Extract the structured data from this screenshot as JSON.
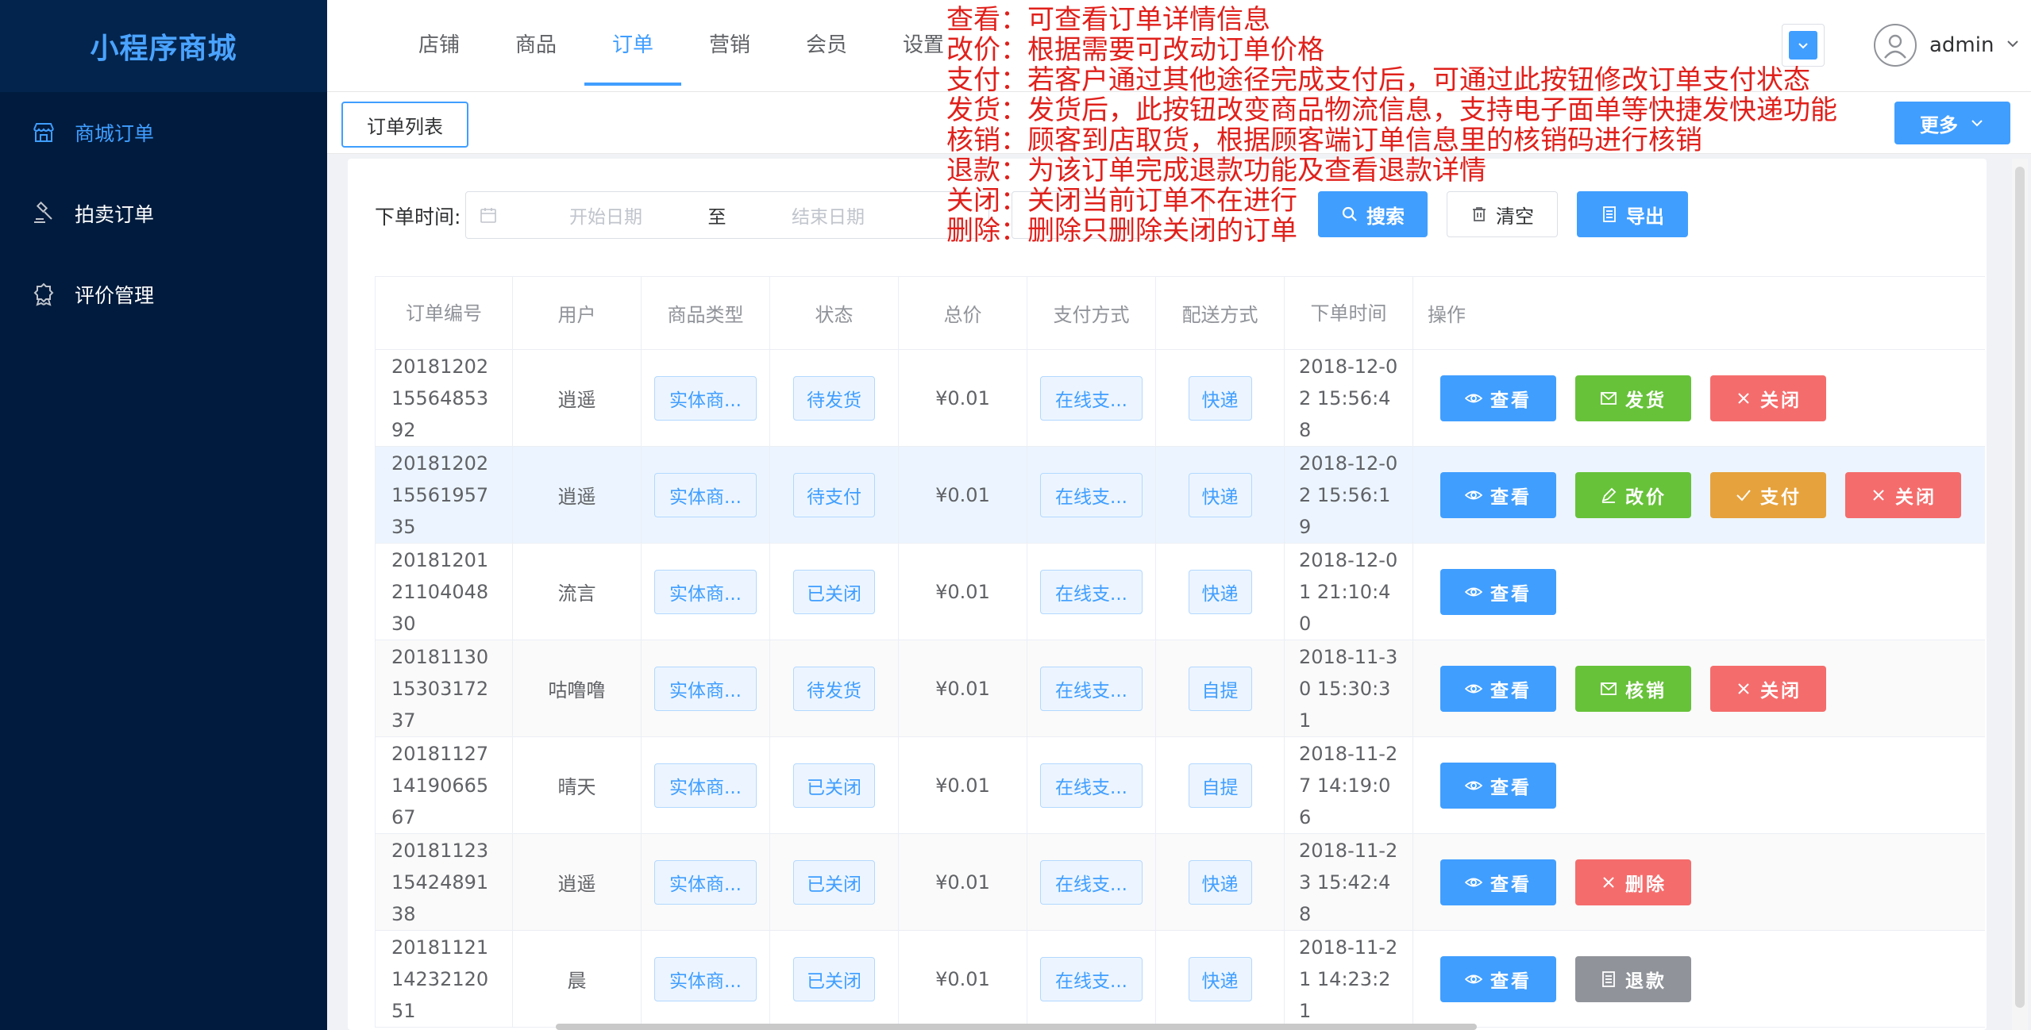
{
  "brand": "小程序商城",
  "sidebar": {
    "items": [
      {
        "label": "商城订单",
        "icon": "store-icon",
        "active": true
      },
      {
        "label": "拍卖订单",
        "icon": "gavel-icon",
        "active": false
      },
      {
        "label": "评价管理",
        "icon": "badge-icon",
        "active": false
      }
    ]
  },
  "nav": {
    "items": [
      "店铺",
      "商品",
      "订单",
      "营销",
      "会员",
      "设置"
    ],
    "active_index": 2
  },
  "user": {
    "name": "admin"
  },
  "tabs": {
    "current": "订单列表",
    "more_label": "更多"
  },
  "filter": {
    "label": "下单时间:",
    "start_placeholder": "开始日期",
    "separator": "至",
    "end_placeholder": "结束日期",
    "search_label": "搜索",
    "clear_label": "清空",
    "export_label": "导出"
  },
  "table": {
    "headers": [
      "订单编号",
      "用户",
      "商品类型",
      "状态",
      "总价",
      "支付方式",
      "配送方式",
      "下单时间",
      "操作"
    ],
    "rows": [
      {
        "id": "201812021556485392",
        "user": "逍遥",
        "type": "实体商...",
        "status": "待发货",
        "total": "¥0.01",
        "pay": "在线支...",
        "ship": "快递",
        "time": "2018-12-02 15:56:48",
        "ops": [
          "查看",
          "发货",
          "关闭"
        ]
      },
      {
        "id": "201812021556195735",
        "user": "逍遥",
        "type": "实体商...",
        "status": "待支付",
        "total": "¥0.01",
        "pay": "在线支...",
        "ship": "快递",
        "time": "2018-12-02 15:56:19",
        "ops": [
          "查看",
          "改价",
          "支付",
          "关闭"
        ]
      },
      {
        "id": "201812012110404830",
        "user": "流言",
        "type": "实体商...",
        "status": "已关闭",
        "total": "¥0.01",
        "pay": "在线支...",
        "ship": "快递",
        "time": "2018-12-01 21:10:40",
        "ops": [
          "查看"
        ]
      },
      {
        "id": "201811301530317237",
        "user": "咕噜噜",
        "type": "实体商...",
        "status": "待发货",
        "total": "¥0.01",
        "pay": "在线支...",
        "ship": "自提",
        "time": "2018-11-30 15:30:31",
        "ops": [
          "查看",
          "核销",
          "关闭"
        ]
      },
      {
        "id": "201811271419066567",
        "user": "晴天",
        "type": "实体商...",
        "status": "已关闭",
        "total": "¥0.01",
        "pay": "在线支...",
        "ship": "自提",
        "time": "2018-11-27 14:19:06",
        "ops": [
          "查看"
        ]
      },
      {
        "id": "201811231542489138",
        "user": "逍遥",
        "type": "实体商...",
        "status": "已关闭",
        "total": "¥0.01",
        "pay": "在线支...",
        "ship": "快递",
        "time": "2018-11-23 15:42:48",
        "ops": [
          "查看",
          "删除"
        ]
      },
      {
        "id": "201811211423212051",
        "user": "晨",
        "type": "实体商...",
        "status": "已关闭",
        "total": "¥0.01",
        "pay": "在线支...",
        "ship": "快递",
        "time": "2018-11-21 14:23:21",
        "ops": [
          "查看",
          "退款"
        ]
      }
    ]
  },
  "annotations": [
    "查看：可查看订单详情信息",
    "改价：根据需要可改动订单价格",
    "支付：若客户通过其他途径完成支付后，可通过此按钮修改订单支付状态",
    "发货：发货后，此按钮改变商品物流信息，支持电子面单等快捷发快递功能",
    "核销：顾客到店取货，根据顾客端订单信息里的核销码进行核销",
    "退款：为该订单完成退款功能及查看退款详情",
    "关闭：关闭当前订单不在进行",
    "删除：删除只删除关闭的订单"
  ],
  "colors": {
    "primary": "#409eff",
    "success": "#67c23a",
    "danger": "#f56c6c",
    "warning": "#e6a23c",
    "info": "#909399",
    "sidebar": "#001b3d",
    "annotation": "#e0201b"
  }
}
